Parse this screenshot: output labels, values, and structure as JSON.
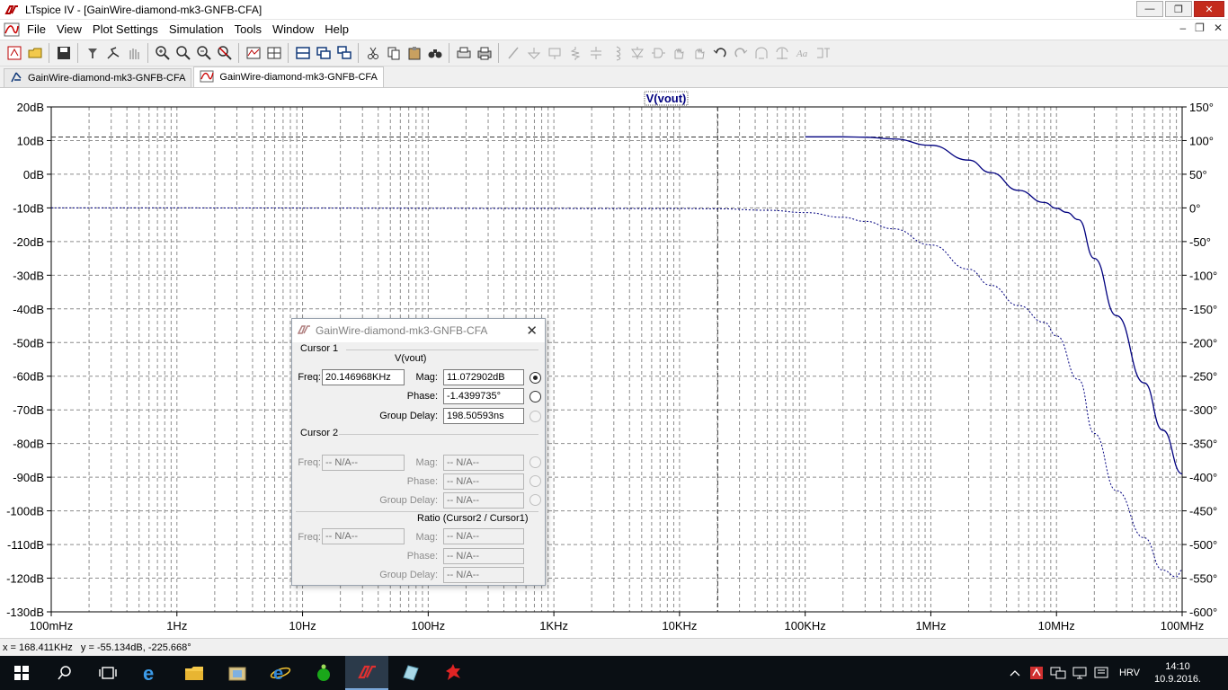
{
  "window": {
    "title": "LTspice IV - [GainWire-diamond-mk3-GNFB-CFA]",
    "buttons": [
      "minimize",
      "maximize",
      "close"
    ]
  },
  "menu": {
    "items": [
      "File",
      "View",
      "Plot Settings",
      "Simulation",
      "Tools",
      "Window",
      "Help"
    ]
  },
  "toolbar": {
    "icons": [
      "new-schematic-icon",
      "open-icon",
      "save-icon",
      "control-panel-icon",
      "run-icon",
      "halt-icon",
      "zoom-in-icon",
      "zoom-area-icon",
      "zoom-out-icon",
      "zoom-cancel-icon",
      "autorange-icon",
      "cursor-icon",
      "tile-vertical-icon",
      "tile-horizontal-icon",
      "cascade-icon",
      "cut-icon",
      "copy-icon",
      "paste-icon",
      "find-icon",
      "print-preview-icon",
      "print-icon",
      "wire-icon",
      "ground-icon",
      "label-net-icon",
      "resistor-icon",
      "capacitor-icon",
      "inductor-icon",
      "diode-icon",
      "component-icon",
      "move-icon",
      "drag-icon",
      "undo-icon",
      "redo-icon",
      "rotate-icon",
      "mirror-icon",
      "text-icon",
      "spice-directive-icon"
    ]
  },
  "tabs": [
    {
      "label": "GainWire-diamond-mk3-GNFB-CFA",
      "icon": "schematic-icon",
      "active": false
    },
    {
      "label": "GainWire-diamond-mk3-GNFB-CFA",
      "icon": "waveform-icon",
      "active": true
    }
  ],
  "plot": {
    "trace_label": "V(vout)",
    "trace_color": "#00007f",
    "grid_color": "#8c8c8c",
    "cursor_color": "#3a3a3a"
  },
  "chart_data": {
    "type": "line",
    "title": "V(vout)",
    "x_scale": "log",
    "xlim": [
      0.1,
      100000000
    ],
    "x_ticks": [
      "100mHz",
      "1Hz",
      "10Hz",
      "100Hz",
      "1KHz",
      "10KHz",
      "100KHz",
      "1MHz",
      "10MHz",
      "100MHz"
    ],
    "y_left_ticks": [
      "20dB",
      "10dB",
      "0dB",
      "-10dB",
      "-20dB",
      "-30dB",
      "-40dB",
      "-50dB",
      "-60dB",
      "-70dB",
      "-80dB",
      "-90dB",
      "-100dB",
      "-110dB",
      "-120dB",
      "-130dB"
    ],
    "ylim_left": [
      -130,
      20
    ],
    "y_right_ticks": [
      "150°",
      "100°",
      "50°",
      "0°",
      "-50°",
      "-100°",
      "-150°",
      "-200°",
      "-250°",
      "-300°",
      "-350°",
      "-400°",
      "-450°",
      "-500°",
      "-550°",
      "-600°"
    ],
    "ylim_right": [
      -600,
      150
    ],
    "grid": true,
    "cursor1": {
      "x": 20146.968,
      "y_db": 11.072902
    },
    "series": [
      {
        "name": "V(vout)",
        "axis": "left",
        "style": "solid",
        "x": [
          100000,
          200000,
          300000,
          500000,
          1000000,
          2000000,
          3000000,
          5000000,
          8000000,
          10000000,
          12000000,
          15000000,
          20000000,
          30000000,
          50000000,
          70000000,
          100000000
        ],
        "y": [
          11.1,
          11.1,
          11.0,
          10.5,
          8.6,
          4.2,
          0.5,
          -4.8,
          -8.4,
          -10.1,
          -11.3,
          -13.5,
          -25,
          -42,
          -62,
          -76,
          -89
        ]
      },
      {
        "name": "V(vout) phase",
        "axis": "right",
        "style": "dashed",
        "x": [
          0.1,
          0.2,
          10000,
          20000,
          50000,
          100000,
          200000,
          300000,
          500000,
          1000000,
          2000000,
          3000000,
          5000000,
          8000000,
          10000000,
          15000000,
          20000000,
          30000000,
          50000000,
          70000000,
          90000000,
          100000000
        ],
        "y": [
          0,
          0,
          -1,
          -1.4,
          -3.5,
          -7,
          -14,
          -20,
          -31,
          -55,
          -91,
          -115,
          -145,
          -170,
          -190,
          -255,
          -335,
          -420,
          -490,
          -538,
          -548,
          -538
        ]
      }
    ]
  },
  "dialog": {
    "title": "GainWire-diamond-mk3-GNFB-CFA",
    "cursor1": {
      "group": "Cursor 1",
      "trace": "V(vout)",
      "freq_label": "Freq:",
      "freq": "20.146968KHz",
      "mag_label": "Mag:",
      "mag": "11.072902dB",
      "phase_label": "Phase:",
      "phase": "-1.4399735°",
      "gd_label": "Group Delay:",
      "gd": "198.50593ns"
    },
    "cursor2": {
      "group": "Cursor 2",
      "freq_label": "Freq:",
      "freq": "-- N/A--",
      "mag_label": "Mag:",
      "mag": "-- N/A--",
      "phase_label": "Phase:",
      "phase": "-- N/A--",
      "gd_label": "Group Delay:",
      "gd": "-- N/A--"
    },
    "ratio": {
      "group": "Ratio (Cursor2 / Cursor1)",
      "freq_label": "Freq:",
      "freq": "-- N/A--",
      "mag_label": "Mag:",
      "mag": "-- N/A--",
      "phase_label": "Phase:",
      "phase": "-- N/A--",
      "gd_label": "Group Delay:",
      "gd": "-- N/A--"
    }
  },
  "status": {
    "text": "x = 168.411KHz   y = -55.134dB, -225.668°"
  },
  "taskbar": {
    "icons": [
      "windows-start-icon",
      "search-icon",
      "task-view-icon",
      "edge-icon",
      "file-explorer-icon",
      "folder-app-icon",
      "internet-explorer-icon",
      "green-app-icon",
      "ltspice-icon",
      "crystal-app-icon",
      "red-app-icon"
    ],
    "tray": {
      "lang": "HRV",
      "time": "14:10",
      "date": "10.9.2016."
    }
  }
}
